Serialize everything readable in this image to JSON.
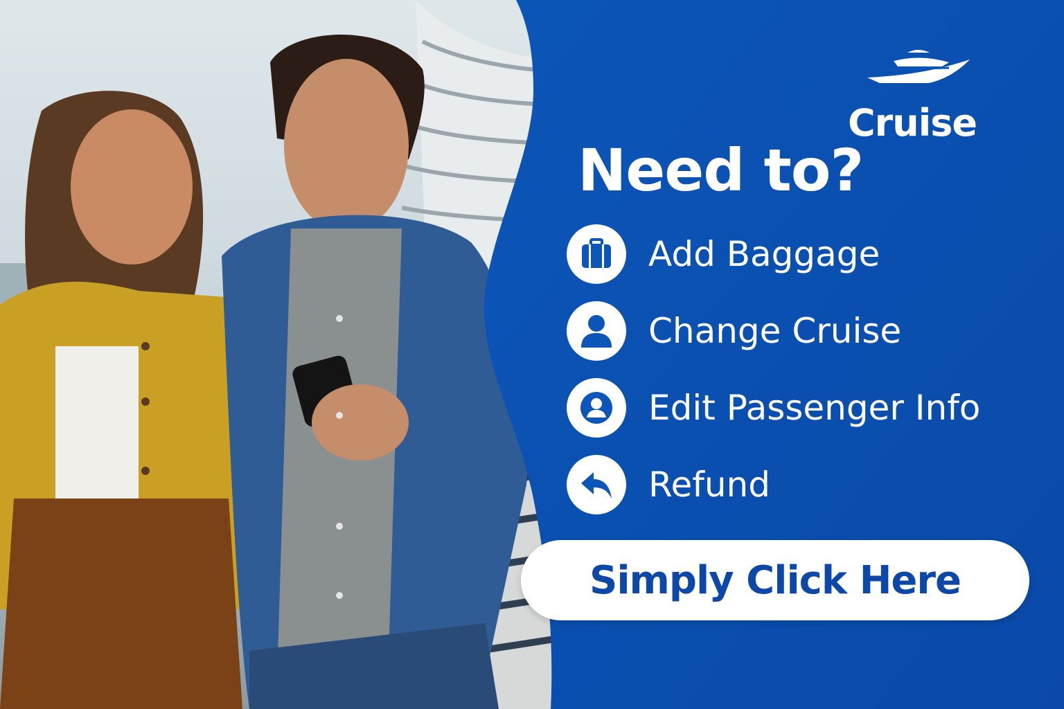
{
  "brand": {
    "name": "Cruise",
    "logo_icon": "cruise-ship-icon"
  },
  "headline": "Need to?",
  "menu": {
    "items": [
      {
        "label": "Add Baggage",
        "icon": "luggage-icon"
      },
      {
        "label": "Change Cruise",
        "icon": "person-icon"
      },
      {
        "label": "Edit Passenger Info",
        "icon": "user-circle-icon"
      },
      {
        "label": "Refund",
        "icon": "reply-arrow-icon"
      }
    ]
  },
  "cta": {
    "label": "Simply Click Here"
  },
  "colors": {
    "panel_blue": "#0a52b4",
    "cta_text": "#0d47a8",
    "white": "#ffffff"
  }
}
